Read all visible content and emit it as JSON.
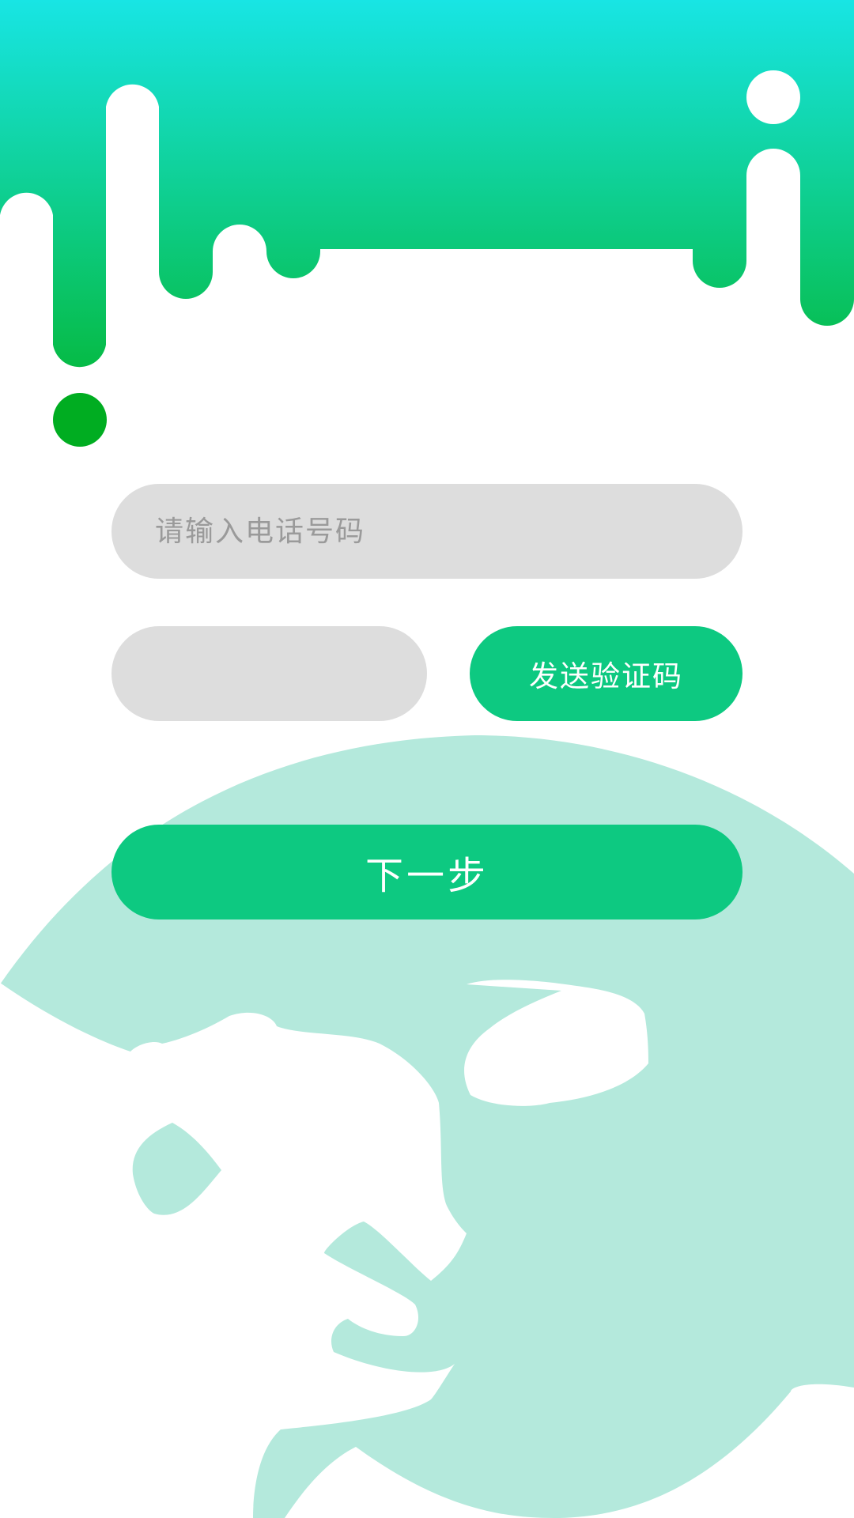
{
  "colors": {
    "header_gradient_top": "#18e5e4",
    "header_gradient_bottom": "#06bb46",
    "drop_dot": "#00ad21",
    "primary_button": "#0dc981",
    "input_background": "#dddddd",
    "mascot_background": "#b4e9dc"
  },
  "form": {
    "phone_placeholder": "请输入电话号码",
    "phone_value": "",
    "code_placeholder": "",
    "code_value": "",
    "send_code_label": "发送验证码",
    "next_label": "下一步"
  }
}
